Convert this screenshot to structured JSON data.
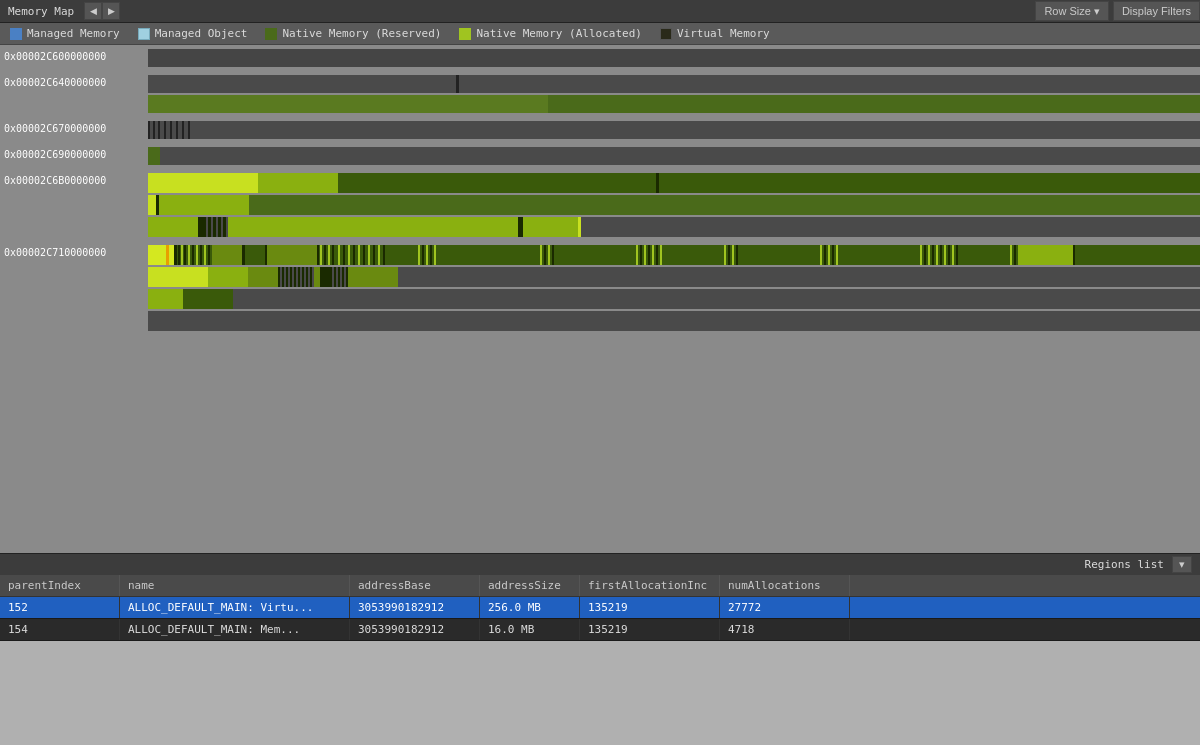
{
  "header": {
    "title": "Memory Map",
    "nav_prev": "◀",
    "nav_next": "▶",
    "row_size_label": "Row Size ▾",
    "display_filters_label": "Display Filters"
  },
  "legend": {
    "items": [
      {
        "id": "managed-memory",
        "color": "#4a80c4",
        "label": "Managed Memory"
      },
      {
        "id": "managed-object",
        "color": "#a0d0e0",
        "label": "Managed Object"
      },
      {
        "id": "native-reserved",
        "color": "#4a6a1a",
        "label": "Native Memory (Reserved)"
      },
      {
        "id": "native-allocated",
        "color": "#a0c420",
        "label": "Native Memory (Allocated)"
      },
      {
        "id": "virtual-memory",
        "color": "#2a2a1a",
        "label": "Virtual Memory"
      }
    ]
  },
  "addresses": [
    {
      "addr": "0x00002C600000000"
    },
    {
      "addr": "0x00002C640000000"
    },
    {
      "addr": "0x00002C670000000"
    },
    {
      "addr": "0x00002C690000000"
    },
    {
      "addr": "0x00002C6B0000000"
    },
    {
      "addr": "0x00002C710000000"
    }
  ],
  "regions_list": {
    "label": "Regions list",
    "dropdown_arrow": "▾"
  },
  "table": {
    "columns": [
      {
        "id": "parentIndex",
        "label": "parentIndex"
      },
      {
        "id": "name",
        "label": "name"
      },
      {
        "id": "addressBase",
        "label": "addressBase"
      },
      {
        "id": "addressSize",
        "label": "addressSize"
      },
      {
        "id": "firstAllocationIndex",
        "label": "firstAllocationInc"
      },
      {
        "id": "numAllocations",
        "label": "numAllocations"
      }
    ],
    "rows": [
      {
        "selected": true,
        "parentIndex": "152",
        "name": "ALLOC_DEFAULT_MAIN: Virtu...",
        "addressBase": "3053990182912",
        "addressSize": "256.0 MB",
        "firstAllocationIndex": "135219",
        "numAllocations": "27772"
      },
      {
        "selected": false,
        "parentIndex": "154",
        "name": "ALLOC_DEFAULT_MAIN: Mem...",
        "addressBase": "3053990182912",
        "addressSize": "16.0 MB",
        "firstAllocationIndex": "135219",
        "numAllocations": "4718"
      }
    ]
  }
}
